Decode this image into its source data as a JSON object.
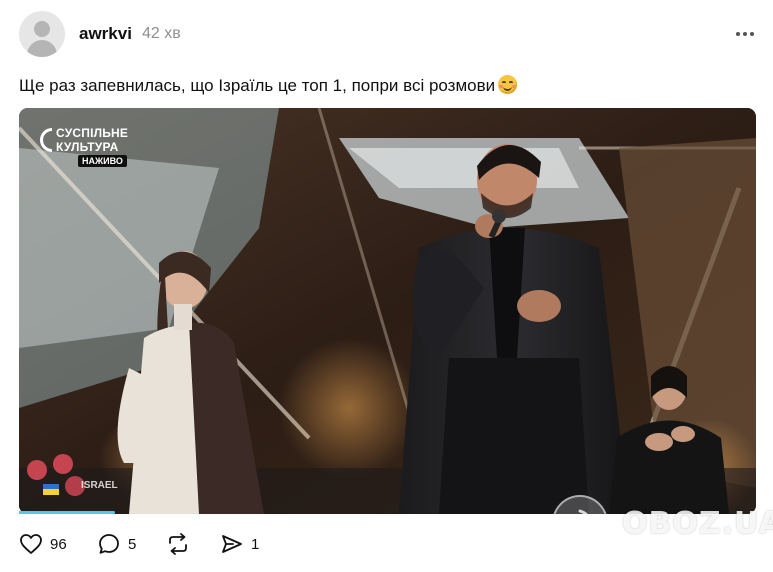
{
  "post": {
    "username": "awrkvi",
    "time": "42 хв",
    "text": "Ще раз запевнилась, що Ізраїль це топ 1, попри всі розмови",
    "emoji": "blushing-smile-emoji"
  },
  "media": {
    "broadcaster_line1": "СУСПІЛЬНЕ",
    "broadcaster_line2": "КУЛЬТУРА",
    "live_label": "НАЖИВО",
    "country_label": "ISRAEL",
    "playback_progress": 0.13
  },
  "actions": {
    "likes": "96",
    "comments": "5",
    "shares": "1"
  },
  "watermark": {
    "text": "OBOZ.UA"
  },
  "colors": {
    "text": "#111111",
    "muted": "#8f8f8f",
    "progress": "#55c8e8"
  }
}
